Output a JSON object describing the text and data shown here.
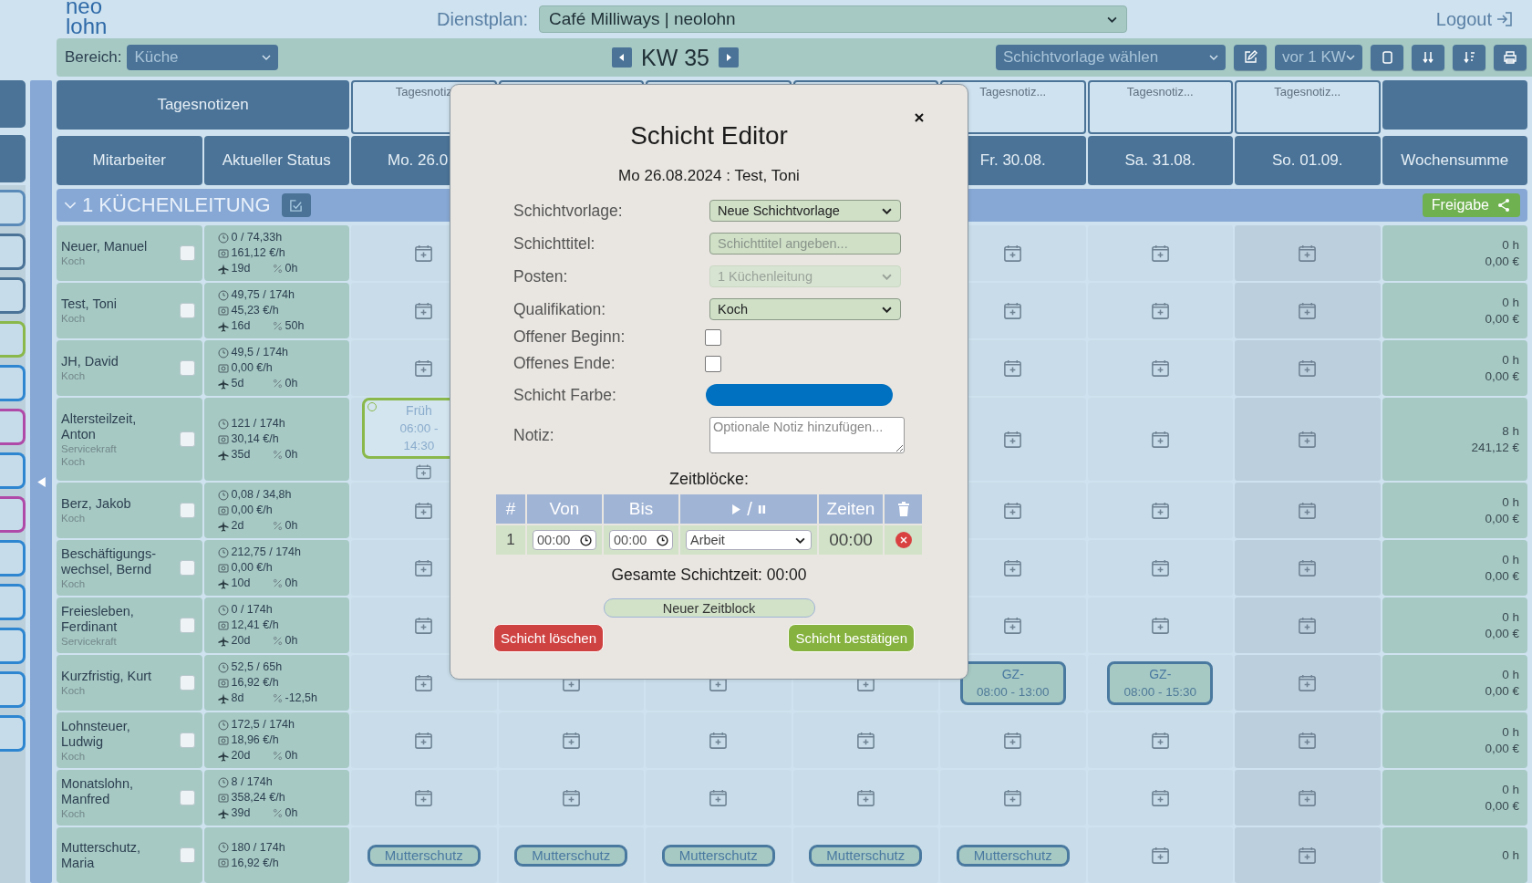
{
  "logo": [
    "neo",
    "lohn"
  ],
  "plan": {
    "label": "Dienstplan:",
    "value": "Café Milliways | neolohn"
  },
  "logout": "Logout",
  "toolbar": {
    "area_label": "Bereich:",
    "area_value": "Küche",
    "week": "KW 35",
    "template_select": "Schichtvorlage wählen",
    "copy_select": "vor 1 KW"
  },
  "side_cards": [
    {
      "kind": "header",
      "color": "#4a7397"
    },
    {
      "kind": "header",
      "color": "#4a7397"
    },
    {
      "kind": "entry",
      "color": "#5a8ab8"
    },
    {
      "kind": "entry",
      "color": "#4a7397"
    },
    {
      "kind": "entry",
      "color": "#4a7397"
    },
    {
      "kind": "entry",
      "color": "#8ab84a"
    },
    {
      "kind": "entry",
      "color": "#2e86d1"
    },
    {
      "kind": "entry",
      "color": "#b04aa8"
    },
    {
      "kind": "entry",
      "color": "#2e86d1"
    },
    {
      "kind": "entry",
      "color": "#b04aa8"
    },
    {
      "kind": "entry",
      "color": "#2e86d1"
    },
    {
      "kind": "entry",
      "color": "#2e86d1"
    },
    {
      "kind": "entry",
      "color": "#2e86d1"
    },
    {
      "kind": "entry",
      "color": "#2e86d1"
    },
    {
      "kind": "entry",
      "color": "#2e86d1"
    }
  ],
  "schedule": {
    "notes_title": "Tagesnotizen",
    "columns": [
      "Mitarbeiter",
      "Aktueller Status"
    ],
    "total_column": "Wochensumme",
    "days": [
      {
        "label": "Mo. 26.0",
        "note": "Tagesnotiz",
        "shaded": false
      },
      {
        "shaded": false
      },
      {
        "shaded": false
      },
      {
        "shaded": false
      },
      {
        "label": "Fr. 30.08.",
        "note": "Tagesnotiz...",
        "shaded": false
      },
      {
        "label": "Sa. 31.08.",
        "note": "Tagesnotiz...",
        "shaded": false
      },
      {
        "label": "So. 01.09.",
        "note": "Tagesnotiz...",
        "shaded": true
      }
    ],
    "group": {
      "title": "1 KÜCHENLEITUNG",
      "expanded": true,
      "release": "Freigabe"
    },
    "employees": [
      {
        "name": "Neuer, Manuel",
        "roles": [
          "Koch"
        ],
        "checked": false,
        "hours": "0 / 74,33h",
        "rate": "161,12 €/h",
        "vacation": "19d",
        "overtime": "0h",
        "days": [
          {
            "kind": "slots",
            "items": [
              {
                "kind": "add"
              }
            ]
          },
          {
            "kind": "covered"
          },
          {
            "kind": "covered"
          },
          {
            "kind": "covered"
          },
          {
            "kind": "slots",
            "items": [
              {
                "kind": "add"
              }
            ]
          },
          {
            "kind": "slots",
            "items": [
              {
                "kind": "add"
              }
            ]
          },
          {
            "kind": "slots",
            "items": [
              {
                "kind": "add"
              }
            ]
          }
        ],
        "total_hours": "0 h",
        "total_cost": "0,00 €"
      },
      {
        "name": "Test, Toni",
        "roles": [
          "Koch"
        ],
        "checked": false,
        "hours": "49,75 / 174h",
        "rate": "45,23 €/h",
        "vacation": "16d",
        "overtime": "50h",
        "days": [
          {
            "kind": "slots",
            "items": [
              {
                "kind": "add"
              }
            ]
          },
          {
            "kind": "covered"
          },
          {
            "kind": "covered"
          },
          {
            "kind": "covered"
          },
          {
            "kind": "slots",
            "items": [
              {
                "kind": "add"
              }
            ]
          },
          {
            "kind": "slots",
            "items": [
              {
                "kind": "add"
              }
            ]
          },
          {
            "kind": "slots",
            "items": [
              {
                "kind": "add"
              }
            ]
          }
        ],
        "total_hours": "0 h",
        "total_cost": "0,00 €"
      },
      {
        "name": "JH, David",
        "roles": [
          "Koch"
        ],
        "checked": false,
        "hours": "49,5 / 174h",
        "rate": "0,00 €/h",
        "vacation": "5d",
        "overtime": "0h",
        "days": [
          {
            "kind": "slots",
            "items": [
              {
                "kind": "add"
              }
            ]
          },
          {
            "kind": "covered"
          },
          {
            "kind": "covered"
          },
          {
            "kind": "covered"
          },
          {
            "kind": "slots",
            "items": [
              {
                "kind": "add"
              }
            ]
          },
          {
            "kind": "slots",
            "items": [
              {
                "kind": "add"
              }
            ]
          },
          {
            "kind": "slots",
            "items": [
              {
                "kind": "add"
              }
            ]
          }
        ],
        "total_hours": "0 h",
        "total_cost": "0,00 €"
      },
      {
        "name": "Altersteilzeit, Anton",
        "roles": [
          "Servicekraft",
          "Koch"
        ],
        "checked": false,
        "hours": "121 / 174h",
        "rate": "30,14 €/h",
        "vacation": "35d",
        "overtime": "0h",
        "days": [
          {
            "kind": "slots",
            "items": [
              {
                "kind": "shift",
                "title": "Früh",
                "time": "06:00 - 14:30",
                "color": "#8ab84a"
              },
              {
                "kind": "add"
              }
            ]
          },
          {
            "kind": "covered"
          },
          {
            "kind": "covered"
          },
          {
            "kind": "covered"
          },
          {
            "kind": "slots",
            "items": [
              {
                "kind": "add"
              }
            ]
          },
          {
            "kind": "slots",
            "items": [
              {
                "kind": "add"
              }
            ]
          },
          {
            "kind": "slots",
            "items": [
              {
                "kind": "add"
              }
            ]
          }
        ],
        "total_hours": "8 h",
        "total_cost": "241,12 €"
      },
      {
        "name": "Berz, Jakob",
        "roles": [
          "Koch"
        ],
        "checked": false,
        "hours": "0,08 / 34,8h",
        "rate": "0,00 €/h",
        "vacation": "2d",
        "overtime": "0h",
        "days": [
          {
            "kind": "slots",
            "items": [
              {
                "kind": "add"
              }
            ]
          },
          {
            "kind": "covered"
          },
          {
            "kind": "covered"
          },
          {
            "kind": "covered"
          },
          {
            "kind": "slots",
            "items": [
              {
                "kind": "add"
              }
            ]
          },
          {
            "kind": "slots",
            "items": [
              {
                "kind": "add"
              }
            ]
          },
          {
            "kind": "slots",
            "items": [
              {
                "kind": "add"
              }
            ]
          }
        ],
        "total_hours": "0 h",
        "total_cost": "0,00 €"
      },
      {
        "name": "Beschäftigungs-wechsel, Bernd",
        "roles": [
          "Koch"
        ],
        "checked": false,
        "hours": "212,75 / 174h",
        "rate": "0,00 €/h",
        "vacation": "10d",
        "overtime": "0h",
        "days": [
          {
            "kind": "slots",
            "items": [
              {
                "kind": "add"
              }
            ]
          },
          {
            "kind": "covered"
          },
          {
            "kind": "covered"
          },
          {
            "kind": "covered"
          },
          {
            "kind": "slots",
            "items": [
              {
                "kind": "add"
              }
            ]
          },
          {
            "kind": "slots",
            "items": [
              {
                "kind": "add"
              }
            ]
          },
          {
            "kind": "slots",
            "items": [
              {
                "kind": "add"
              }
            ]
          }
        ],
        "total_hours": "0 h",
        "total_cost": "0,00 €"
      },
      {
        "name": "Freiesleben, Ferdinant",
        "roles": [
          "Servicekraft"
        ],
        "checked": false,
        "hours": "0 / 174h",
        "rate": "12,41 €/h",
        "vacation": "20d",
        "overtime": "0h",
        "days": [
          {
            "kind": "slots",
            "items": [
              {
                "kind": "add"
              }
            ]
          },
          {
            "kind": "covered"
          },
          {
            "kind": "covered"
          },
          {
            "kind": "covered"
          },
          {
            "kind": "slots",
            "items": [
              {
                "kind": "add"
              }
            ]
          },
          {
            "kind": "slots",
            "items": [
              {
                "kind": "add"
              }
            ]
          },
          {
            "kind": "slots",
            "items": [
              {
                "kind": "add"
              }
            ]
          }
        ],
        "total_hours": "0 h",
        "total_cost": "0,00 €"
      },
      {
        "name": "Kurzfristig, Kurt",
        "roles": [
          "Koch"
        ],
        "checked": false,
        "hours": "52,5 / 65h",
        "rate": "16,92 €/h",
        "vacation": "8d",
        "overtime": "-12,5h",
        "days": [
          {
            "kind": "slots",
            "items": [
              {
                "kind": "add"
              }
            ]
          },
          {
            "kind": "slots",
            "items": [
              {
                "kind": "add"
              }
            ]
          },
          {
            "kind": "slots",
            "items": [
              {
                "kind": "add"
              }
            ]
          },
          {
            "kind": "slots",
            "items": [
              {
                "kind": "add"
              }
            ]
          },
          {
            "kind": "slots",
            "items": [
              {
                "kind": "shift",
                "title": "GZ-",
                "time": "08:00 - 13:00",
                "color": "#4a79a0"
              }
            ]
          },
          {
            "kind": "slots",
            "items": [
              {
                "kind": "shift",
                "title": "GZ-",
                "time": "08:00 - 15:30",
                "color": "#4a79a0"
              }
            ]
          },
          {
            "kind": "slots",
            "items": [
              {
                "kind": "add"
              }
            ]
          }
        ],
        "total_hours": "0 h",
        "total_cost": "0,00 €"
      },
      {
        "name": "Lohnsteuer, Ludwig",
        "roles": [
          "Koch"
        ],
        "checked": false,
        "hours": "172,5 / 174h",
        "rate": "18,96 €/h",
        "vacation": "20d",
        "overtime": "0h",
        "days": [
          {
            "kind": "slots",
            "items": [
              {
                "kind": "add"
              }
            ]
          },
          {
            "kind": "slots",
            "items": [
              {
                "kind": "add"
              }
            ]
          },
          {
            "kind": "slots",
            "items": [
              {
                "kind": "add"
              }
            ]
          },
          {
            "kind": "slots",
            "items": [
              {
                "kind": "add"
              }
            ]
          },
          {
            "kind": "slots",
            "items": [
              {
                "kind": "add"
              }
            ]
          },
          {
            "kind": "slots",
            "items": [
              {
                "kind": "add"
              }
            ]
          },
          {
            "kind": "slots",
            "items": [
              {
                "kind": "add"
              }
            ]
          }
        ],
        "total_hours": "0 h",
        "total_cost": "0,00 €"
      },
      {
        "name": "Monatslohn, Manfred",
        "roles": [
          "Koch"
        ],
        "checked": false,
        "hours": "8 / 174h",
        "rate": "358,24 €/h",
        "vacation": "39d",
        "overtime": "0h",
        "days": [
          {
            "kind": "slots",
            "items": [
              {
                "kind": "add"
              }
            ]
          },
          {
            "kind": "slots",
            "items": [
              {
                "kind": "add"
              }
            ]
          },
          {
            "kind": "slots",
            "items": [
              {
                "kind": "add"
              }
            ]
          },
          {
            "kind": "slots",
            "items": [
              {
                "kind": "add"
              }
            ]
          },
          {
            "kind": "slots",
            "items": [
              {
                "kind": "add"
              }
            ]
          },
          {
            "kind": "slots",
            "items": [
              {
                "kind": "add"
              }
            ]
          },
          {
            "kind": "slots",
            "items": [
              {
                "kind": "add"
              }
            ]
          }
        ],
        "total_hours": "0 h",
        "total_cost": "0,00 €"
      },
      {
        "name": "Mutterschutz, Maria",
        "checked": false,
        "hours": "180 / 174h",
        "rate": "16,92 €/h",
        "days": [
          {
            "kind": "slots",
            "items": [
              {
                "kind": "absence",
                "label": "Mutterschutz"
              }
            ]
          },
          {
            "kind": "slots",
            "items": [
              {
                "kind": "absence",
                "label": "Mutterschutz"
              }
            ]
          },
          {
            "kind": "slots",
            "items": [
              {
                "kind": "absence",
                "label": "Mutterschutz"
              }
            ]
          },
          {
            "kind": "slots",
            "items": [
              {
                "kind": "absence",
                "label": "Mutterschutz"
              }
            ]
          },
          {
            "kind": "slots",
            "items": [
              {
                "kind": "absence",
                "label": "Mutterschutz"
              }
            ]
          },
          {
            "kind": "slots",
            "items": [
              {
                "kind": "add"
              }
            ]
          },
          {
            "kind": "slots",
            "items": [
              {
                "kind": "add"
              }
            ]
          }
        ],
        "total_hours": "0 h"
      }
    ]
  },
  "dialog": {
    "title": "Schicht Editor",
    "subtitle": "Mo 26.08.2024 : Test, Toni",
    "fields": [
      {
        "kind": "select",
        "label": "Schichtvorlage:",
        "value": "Neue Schichtvorlage",
        "disabled": false
      },
      {
        "kind": "input",
        "label": "Schichttitel:",
        "placeholder": "Schichttitel angeben..."
      },
      {
        "kind": "select",
        "label": "Posten:",
        "value": "1 Küchenleitung",
        "disabled": true
      },
      {
        "kind": "select",
        "label": "Qualifikation:",
        "value": "Koch",
        "disabled": false
      },
      {
        "kind": "checkbox",
        "label": "Offener Beginn:",
        "checked": false
      },
      {
        "kind": "checkbox",
        "label": "Offenes Ende:",
        "checked": false
      },
      {
        "kind": "color",
        "label": "Schicht Farbe:",
        "color": "#0070c0"
      },
      {
        "kind": "textarea",
        "label": "Notiz:",
        "placeholder": "Optionale Notiz hinzufügen..."
      }
    ],
    "blocks_title": "Zeitblöcke:",
    "block_columns": [
      {
        "kind": "text",
        "label": "#"
      },
      {
        "kind": "text",
        "label": "Von"
      },
      {
        "kind": "text",
        "label": "Bis"
      },
      {
        "kind": "play_pause",
        "label": "/"
      },
      {
        "kind": "text",
        "label": "Zeiten"
      },
      {
        "kind": "trash"
      }
    ],
    "blocks": [
      {
        "number": "1",
        "from": "00:00",
        "to": "00:00",
        "type": "Arbeit",
        "duration": "00:00"
      }
    ],
    "total": "Gesamte Schichtzeit: 00:00",
    "add_block": "Neuer Zeitblock",
    "delete": "Schicht löschen",
    "confirm": "Schicht bestätigen"
  }
}
